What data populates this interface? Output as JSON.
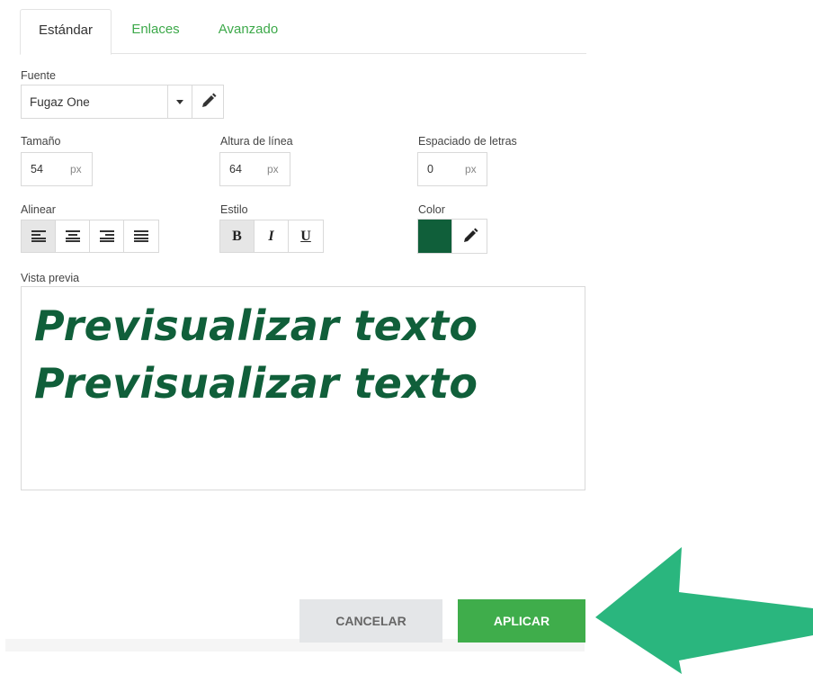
{
  "tabs": [
    {
      "label": "Estándar",
      "active": true
    },
    {
      "label": "Enlaces",
      "active": false
    },
    {
      "label": "Avanzado",
      "active": false
    }
  ],
  "font": {
    "label": "Fuente",
    "value": "Fugaz One"
  },
  "size": {
    "label": "Tamaño",
    "value": "54",
    "unit": "px"
  },
  "line_height": {
    "label": "Altura de línea",
    "value": "64",
    "unit": "px"
  },
  "letter_spacing": {
    "label": "Espaciado de letras",
    "value": "0",
    "unit": "px"
  },
  "align": {
    "label": "Alinear",
    "options": [
      "left",
      "center",
      "right",
      "justify"
    ],
    "selected": "left"
  },
  "style": {
    "label": "Estilo",
    "bold": "B",
    "italic": "I",
    "underline": "U",
    "bold_active": true
  },
  "color": {
    "label": "Color",
    "value": "#105f3a"
  },
  "preview": {
    "label": "Vista previa",
    "lines": [
      "Previsualizar texto",
      "Previsualizar texto"
    ]
  },
  "buttons": {
    "cancel": "CANCELAR",
    "apply": "APLICAR"
  },
  "colors": {
    "accent": "#3fad4b",
    "tab_link": "#3da94a",
    "arrow": "#2ab67e"
  }
}
